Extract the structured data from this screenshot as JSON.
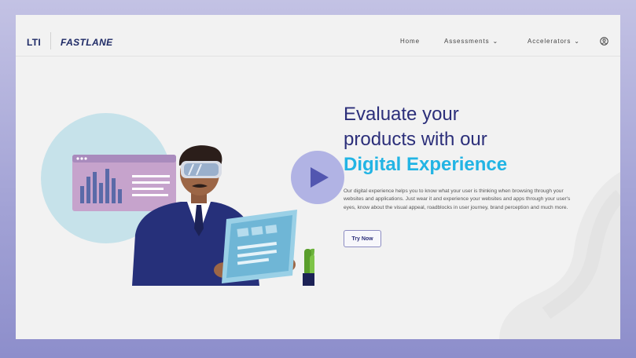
{
  "brand": {
    "lti": "LTI",
    "product": "FASTLANE"
  },
  "nav": {
    "home": "Home",
    "assessments": "Assessments",
    "accelerators": "Accelerators",
    "chevron": "⌄"
  },
  "hero": {
    "line1": "Evaluate your",
    "line2": "products with our",
    "accent": "Digital Experience",
    "description": "Our digital experience helps you to know what your user is thinking when browsing through your websites and applications. Just wear it and experience your websites and apps through your user's eyes, know about the visual appeal, roadblocks in user journey, brand perception and much more.",
    "cta": "Try Now"
  },
  "colors": {
    "brand_navy": "#1e2a66",
    "heading": "#2c2f7a",
    "accent": "#22b4e4",
    "play": "#5256b0"
  },
  "icons": [
    "user-icon",
    "play-icon",
    "chevron-down-icon"
  ]
}
